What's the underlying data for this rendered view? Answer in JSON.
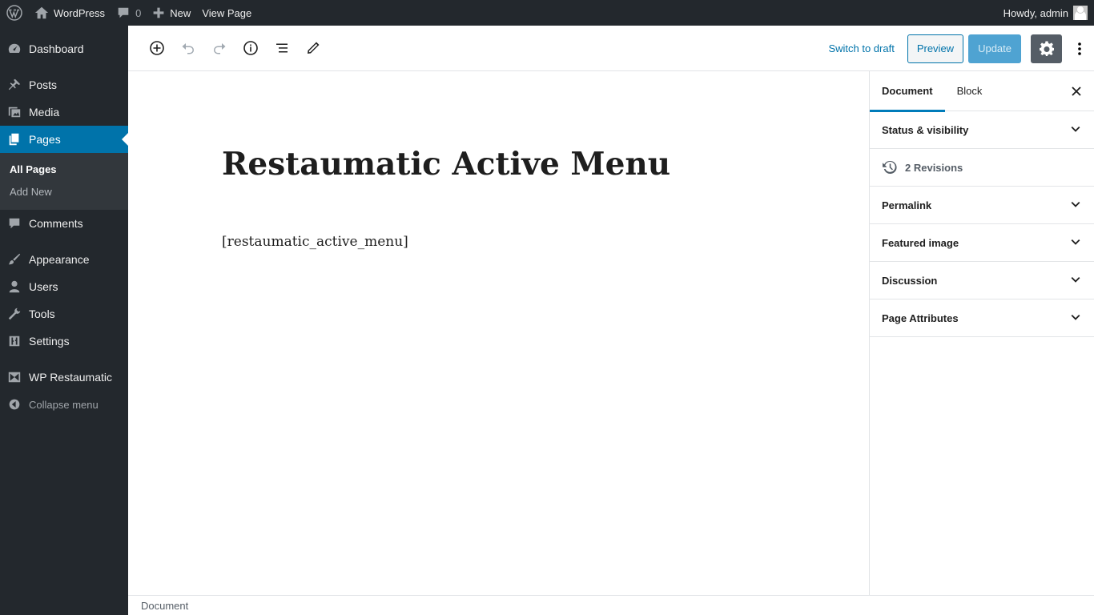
{
  "admin_bar": {
    "site_name": "WordPress",
    "comments_count": "0",
    "new_label": "New",
    "view_page_label": "View Page",
    "howdy_label": "Howdy, admin"
  },
  "sidebar": {
    "items": [
      {
        "label": "Dashboard",
        "icon": "dashboard-icon"
      },
      {
        "label": "Posts",
        "icon": "pin-icon"
      },
      {
        "label": "Media",
        "icon": "media-icon"
      },
      {
        "label": "Pages",
        "icon": "pages-icon"
      },
      {
        "label": "Comments",
        "icon": "comment-icon"
      },
      {
        "label": "Appearance",
        "icon": "brush-icon"
      },
      {
        "label": "Users",
        "icon": "user-icon"
      },
      {
        "label": "Tools",
        "icon": "wrench-icon"
      },
      {
        "label": "Settings",
        "icon": "sliders-icon"
      },
      {
        "label": "WP Restaumatic",
        "icon": "plugin-icon"
      }
    ],
    "submenu": [
      "All Pages",
      "Add New"
    ],
    "collapse_label": "Collapse menu"
  },
  "toolbar": {
    "switch_draft_label": "Switch to draft",
    "preview_label": "Preview",
    "update_label": "Update"
  },
  "editor": {
    "title": "Restaumatic Active Menu",
    "content": "[restaumatic_active_menu]"
  },
  "settings_sidebar": {
    "tabs": [
      "Document",
      "Block"
    ],
    "panels": [
      "Status & visibility",
      "Permalink",
      "Featured image",
      "Discussion",
      "Page Attributes"
    ],
    "revisions_label": "2 Revisions"
  },
  "footer": {
    "breadcrumb": "Document"
  },
  "colors": {
    "admin_dark": "#23282d",
    "accent": "#0073aa",
    "update_button": "#4fa3d2"
  }
}
